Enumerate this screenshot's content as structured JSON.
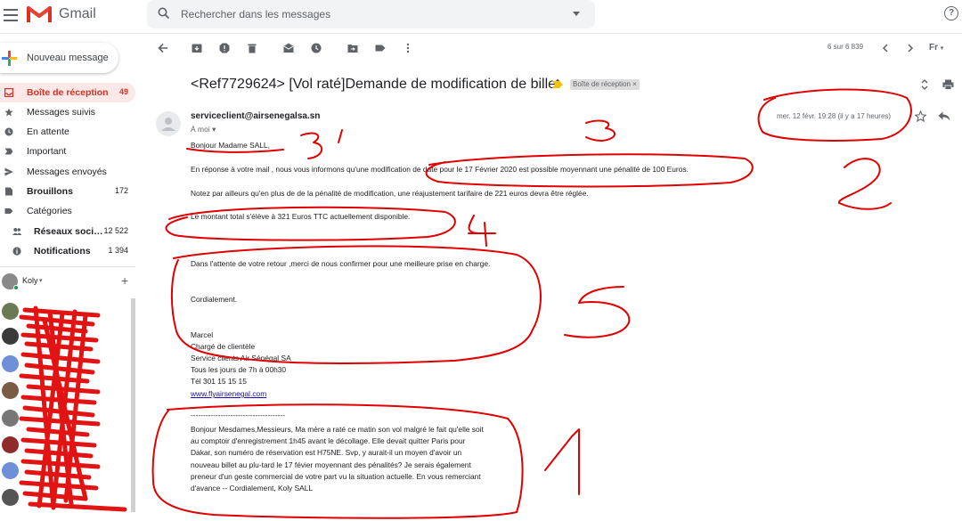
{
  "header": {
    "app_name": "Gmail",
    "search_placeholder": "Rechercher dans les messages"
  },
  "sidebar": {
    "compose_label": "Nouveau message",
    "items": [
      {
        "label": "Boîte de réception",
        "count": "49",
        "icon": "inbox-icon"
      },
      {
        "label": "Messages suivis",
        "count": "",
        "icon": "star-icon"
      },
      {
        "label": "En attente",
        "count": "",
        "icon": "clock-icon"
      },
      {
        "label": "Important",
        "count": "",
        "icon": "important-icon"
      },
      {
        "label": "Messages envoyés",
        "count": "",
        "icon": "send-icon"
      },
      {
        "label": "Brouillons",
        "count": "172",
        "icon": "draft-icon"
      },
      {
        "label": "Catégories",
        "count": "",
        "icon": "label-icon"
      },
      {
        "label": "Réseaux soci…",
        "count": "12 522",
        "icon": "people-icon"
      },
      {
        "label": "Notifications",
        "count": "1 394",
        "icon": "info-icon"
      }
    ],
    "hangouts_user": "Koly"
  },
  "toolbar": {
    "pager": "6 sur 6 839",
    "lang": "Fr"
  },
  "email": {
    "subject": "<Ref7729624> [Vol raté]Demande de modification de billet",
    "label_chip": "Boîte de réception ×",
    "sender": "serviceclient@airsenegalsa.sn",
    "to": "À moi ▾",
    "date": "mer. 12 févr. 19:28 (il y a 17 heures)",
    "greeting": "Bonjour Madame SALL,",
    "p1": "En réponse à votre mail , nous vous informons qu'une modification de date pour le 17 Février 2020 est possible moyennant une pénalité de 100 Euros.",
    "p2": "Notez par ailleurs  qu'en plus de de la pénalité de modification, une réajustement tarifaire  de 221 euros devra être réglée.",
    "p3": "Le montant total s'élève à 321 Euros  TTC actuellement disponible.",
    "p4": "Dans l'attente de votre retour ,merci de nous confirmer pour une meilleure prise en charge.",
    "closing": "Cordialement.",
    "sig_name": "Marcel",
    "sig_role": "Chargé de clientèle",
    "sig_dept": "Service clients Air Sénégal SA",
    "sig_hours": "Tous les jours de 7h à 00h30",
    "sig_tel": "Tél  301 15 15 15",
    "sig_link": "www.flyairsenegal.com",
    "divider": "--------------------------------------",
    "quoted": "Bonjour Mesdames,Messieurs, Ma mère a raté ce matin son vol malgré le fait qu'elle soit au comptoir d'enregistrement 1h45 avant le décollage. Elle devait quitter Paris pour Dakar, son numéro de réservation est H75NE. Svp, y aurait-il un moyen d'avoir un nouveau billet au plu-tard le 17 févier moyennant des pénalités? Je serais également preneur d'un geste commercial de votre part vu la situation actuelle. En vous remerciant d'avance -- Cordialement, Koly SALL"
  },
  "annotations": {
    "n1": "1",
    "n2": "2",
    "n3": "3",
    "n3p": "3'",
    "n4": "4",
    "n5": "5"
  },
  "colors": {
    "accent": "#d93025",
    "annotation": "#e00000",
    "link": "#1a0dab"
  }
}
